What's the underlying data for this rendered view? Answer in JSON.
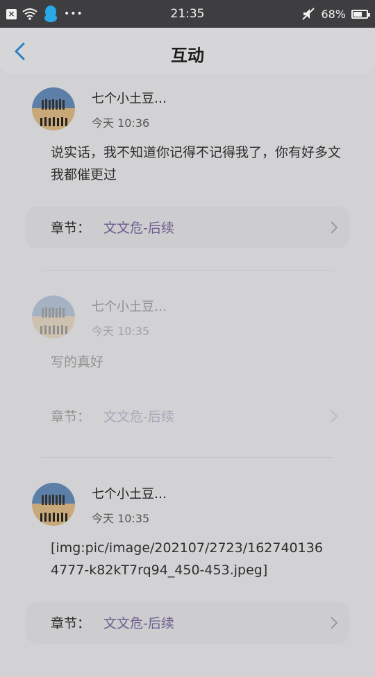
{
  "status_bar": {
    "time": "21:35",
    "battery": "68%",
    "battery_level": 0.68
  },
  "header": {
    "title": "互动"
  },
  "posts": [
    {
      "username": "七个小土豆…",
      "time": "今天 10:36",
      "message": "说实话，我不知道你记得不记得我了，你有好多文我都催更过",
      "chapter_label": "章节：",
      "chapter_value": "文文危-后续"
    },
    {
      "username": "七个小土豆…",
      "time": "今天 10:35",
      "message": "写的真好",
      "chapter_label": "章节：",
      "chapter_value": "文文危-后续"
    },
    {
      "username": "七个小土豆…",
      "time": "今天 10:35",
      "message": "[img:pic/image/202107/2723/1627401364777-k82kT7rq94_450-453.jpeg]",
      "chapter_label": "章节：",
      "chapter_value": "文文危-后续"
    }
  ],
  "icons": {
    "back": "chevron-left-icon",
    "chapter_arrow": "chevron-right-icon"
  }
}
